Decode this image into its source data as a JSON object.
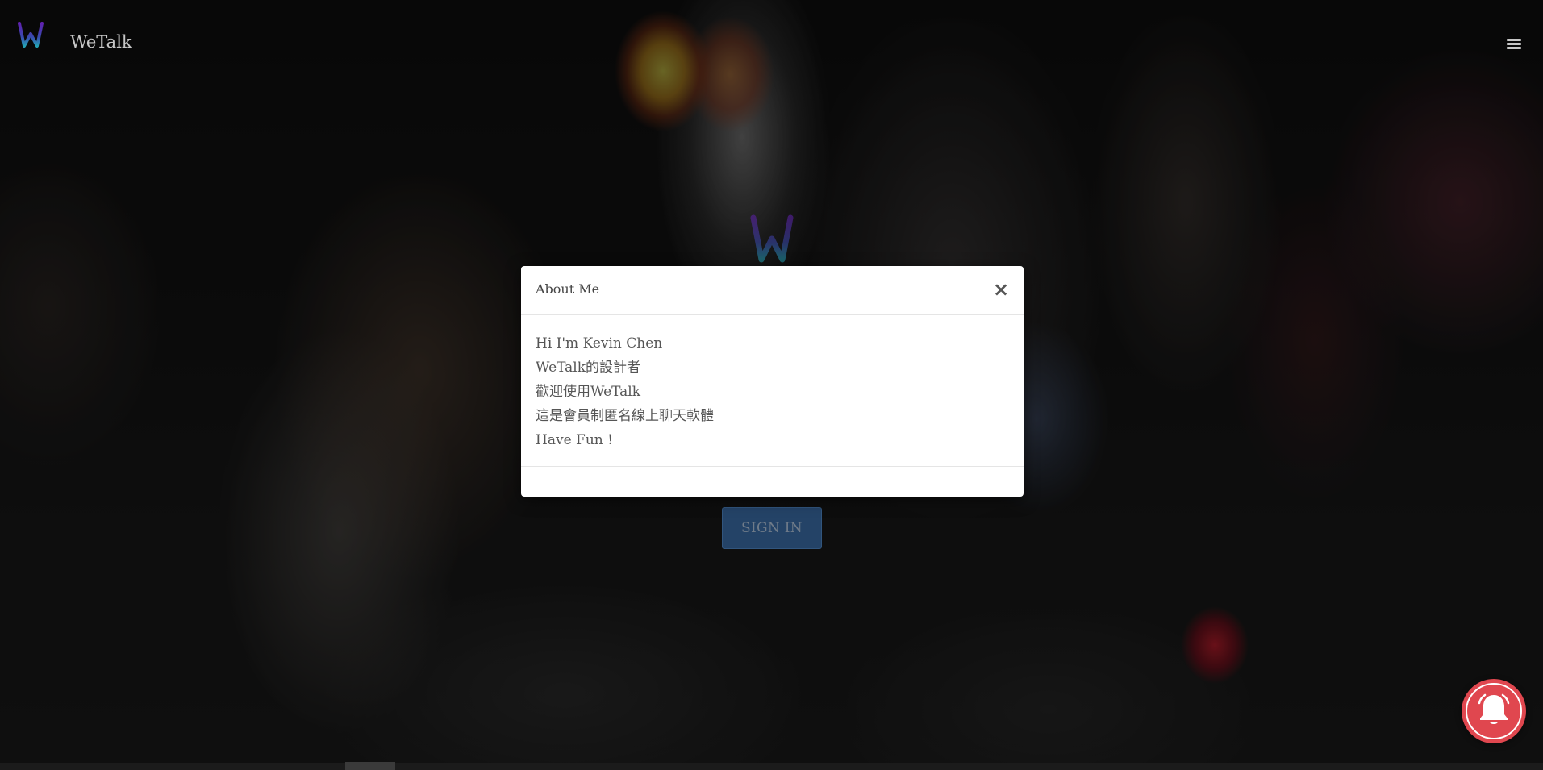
{
  "header": {
    "brand_name": "WeTalk",
    "logo_icon": "wetalk-w-logo",
    "menu_icon": "hamburger-menu-icon"
  },
  "hero": {
    "logo_icon": "wetalk-w-logo",
    "signin_label": "SIGN IN"
  },
  "modal": {
    "title": "About Me",
    "close_label": "×",
    "lines": [
      "Hi I'm Kevin Chen",
      "WeTalk的設計者",
      "歡迎使用WeTalk",
      "這是會員制匿名線上聊天軟體",
      "Have Fun !"
    ]
  },
  "notification": {
    "icon": "bell-icon",
    "color": "#e0474f"
  },
  "colors": {
    "logo_gradient_top": "#6a2bd6",
    "logo_gradient_bottom": "#2fc6e8",
    "signin_bg": "#2f5784"
  }
}
